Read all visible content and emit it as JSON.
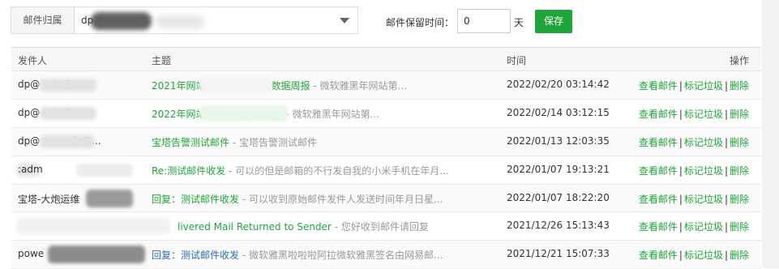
{
  "toolbar": {
    "owner_label": "邮件归属",
    "owner_value": "dp",
    "retention_label": "邮件保留时间：",
    "retention_value": "0",
    "retention_unit": "天",
    "save_label": "保存"
  },
  "table": {
    "headers": {
      "sender": "发件人",
      "subject": "主题",
      "time": "时间",
      "actions": "操作"
    },
    "action_labels": {
      "view": "查看邮件",
      "spam": "标记垃圾",
      "delete": "删除"
    },
    "rows": [
      {
        "sender": "dp@            <dp@...",
        "subject": "2021年网站\\              yw.cn第50周数据周报",
        "preview": " - 微软雅黑年网站第...",
        "time": "2022/02/20 03:14:42"
      },
      {
        "sender": "dp@            <dp@...",
        "subject": "2022年网站\\              n第6周数据周报",
        "preview": " - 微软雅黑年网站第...",
        "time": "2022/02/14 03:12:15"
      },
      {
        "sender": "dp@            om <dp@...",
        "subject": "宝塔告警测试邮件",
        "preview": " - 宝塔告警测试邮件",
        "time": "2022/01/13 12:03:35"
      },
      {
        "sender": "   :adm",
        "subject": "Re:测试邮件收发",
        "preview": " - 可以的但是邮箱的不行发自我的小米手机在年月...",
        "time": "2022/01/07 19:13:21"
      },
      {
        "sender": "宝塔-大炮运维",
        "subject": "回复：测试邮件收发",
        "preview": " - 可以收到原始邮件发件人发送时间年月日星...",
        "time": "2022/01/07 18:22:20"
      },
      {
        "sender": "",
        "subject": "livered Mail Returned to Sender",
        "preview": " - 您好收到邮件请回复",
        "time": "2021/12/26 15:13:43"
      },
      {
        "sender": "powe",
        "subject": "回复：测试邮件收发",
        "preview": " - 微软雅黑啦啦啦阿拉微软雅黑签名由网易邮...",
        "time": "2021/12/21 15:07:33"
      }
    ]
  }
}
